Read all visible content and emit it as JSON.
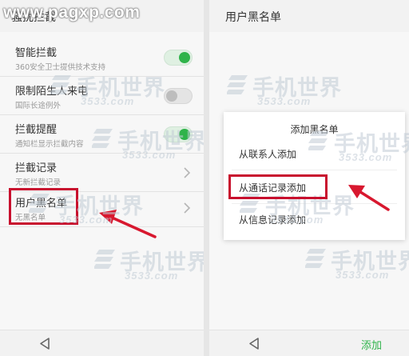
{
  "watermark": {
    "site": "www.pagxp.com",
    "logo_text": "手机世界",
    "logo_number": "3533.com"
  },
  "left_screen": {
    "header_title": "骚扰拦截",
    "rows": [
      {
        "title": "智能拦截",
        "subtitle": "360安全卫士提供技术支持",
        "control": "toggle",
        "state": "on"
      },
      {
        "title": "限制陌生人来电",
        "subtitle": "国际长途例外",
        "control": "toggle",
        "state": "off"
      },
      {
        "title": "拦截提醒",
        "subtitle": "通知栏显示拦截内容",
        "control": "toggle",
        "state": "on"
      },
      {
        "title": "拦截记录",
        "subtitle": "无新拦截记录",
        "control": "chevron"
      },
      {
        "title": "用户黑名单",
        "subtitle": "无黑名单",
        "control": "chevron"
      }
    ],
    "nav_icon": "back-triangle-icon"
  },
  "right_screen": {
    "header_title": "用户黑名单",
    "dialog": {
      "title": "添加黑名单",
      "options": [
        "从联系人添加",
        "从通话记录添加",
        "从信息记录添加"
      ]
    },
    "bottom_action": "添加",
    "nav_icon": "back-triangle-icon"
  },
  "colors": {
    "accent_green": "#2fb34a",
    "highlight_red": "#c8102e",
    "arrow_red": "#d8182f"
  }
}
